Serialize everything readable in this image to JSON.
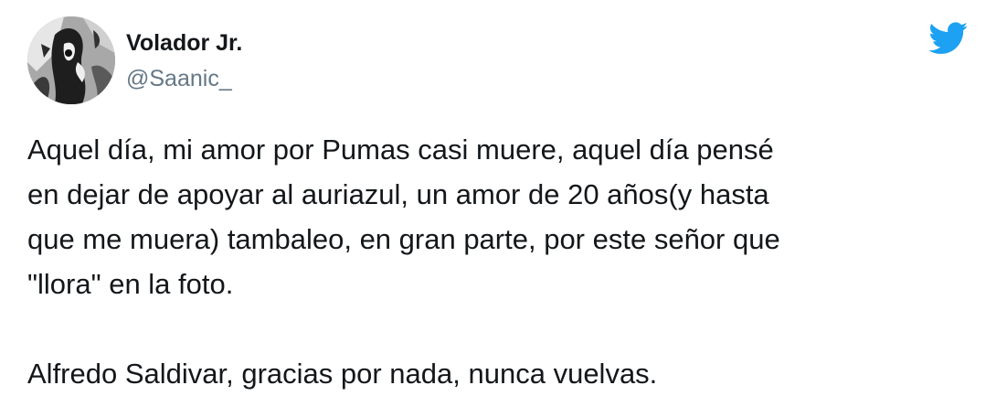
{
  "tweet": {
    "author": {
      "display_name": "Volador Jr.",
      "handle": "@Saanic_"
    },
    "text": "Aquel día, mi amor por Pumas casi muere, aquel día pensé\nen dejar de apoyar al auriazul, un amor de 20 años(y hasta\nque me muera) tambaleo, en gran parte, por este señor que\n\"llora\" en la foto.\n\nAlfredo Saldivar, gracias por nada, nunca vuelvas.",
    "brand_icon": "twitter-bird-icon"
  },
  "colors": {
    "brand": "#1da1f2",
    "text": "#14171a",
    "secondary_text": "#657786",
    "background": "#ffffff"
  }
}
